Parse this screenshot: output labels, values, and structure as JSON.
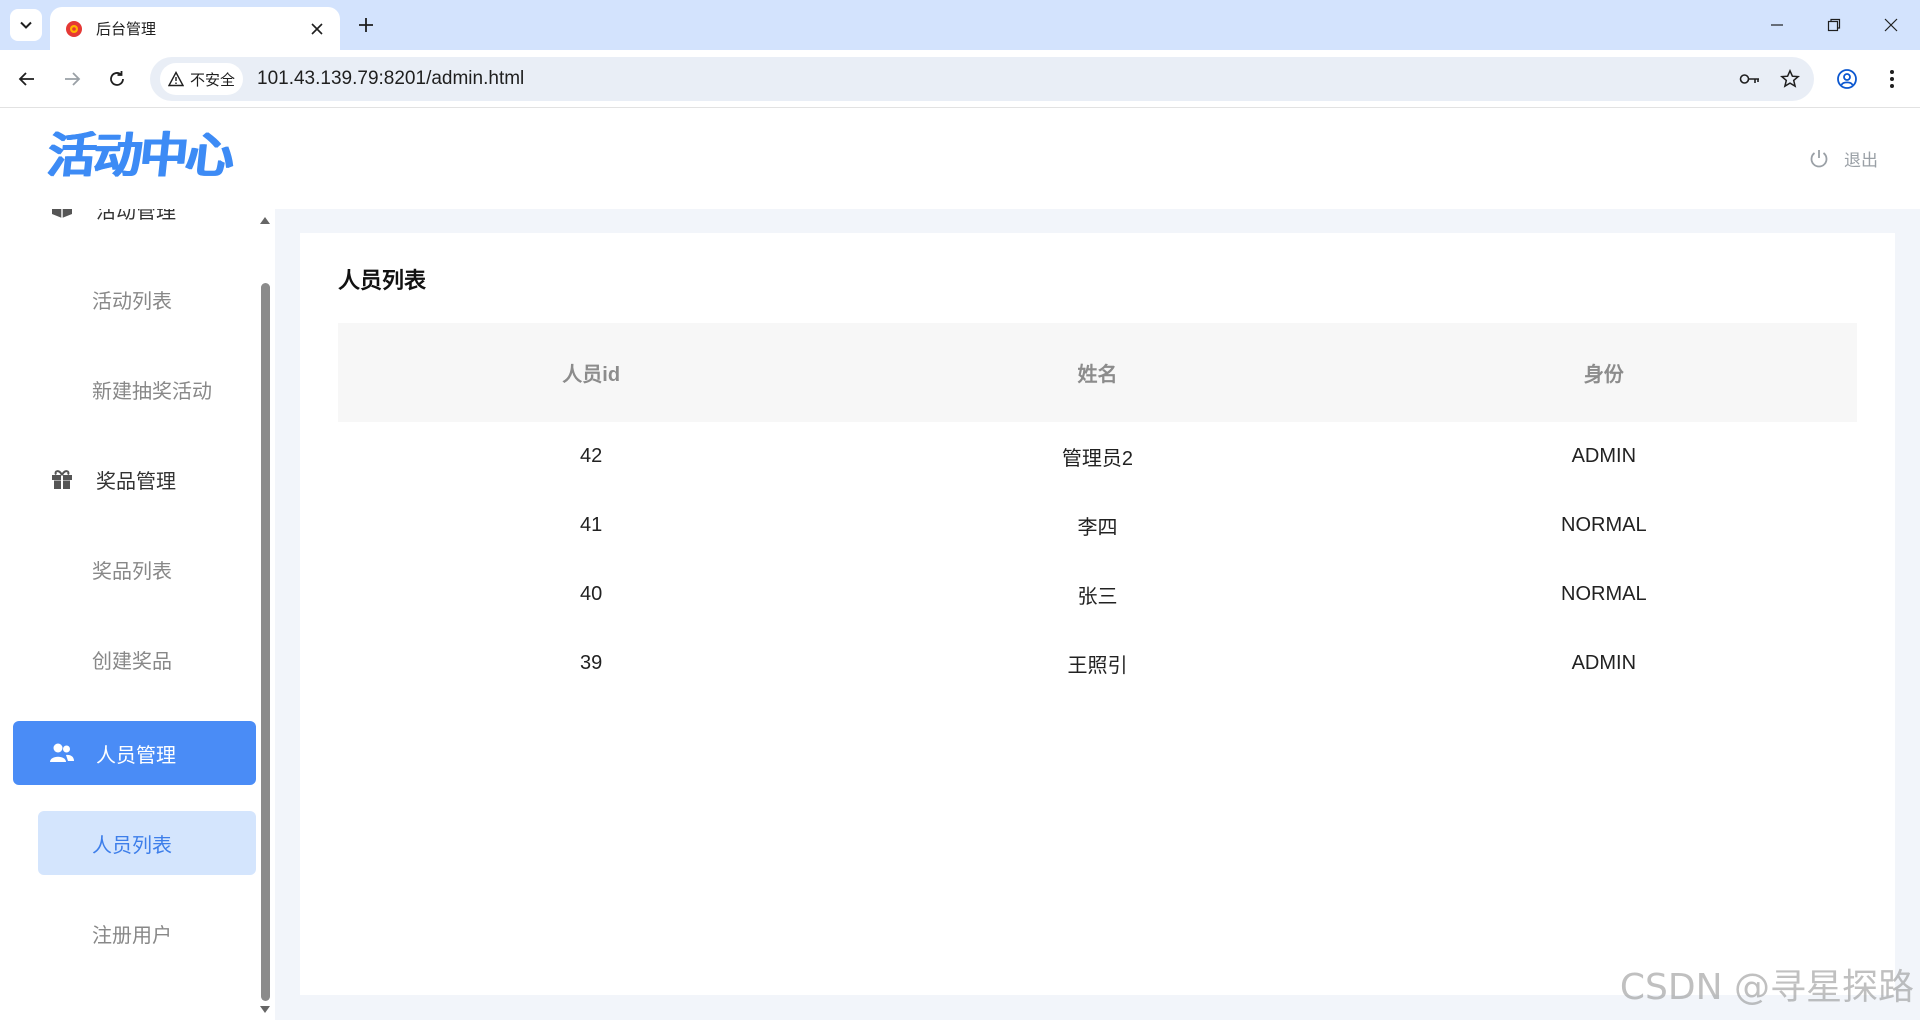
{
  "browser": {
    "tab_title": "后台管理",
    "security_label": "不安全",
    "url": "101.43.139.79:8201/admin.html"
  },
  "header": {
    "logo_text": "活动中心",
    "logout_label": "退出"
  },
  "sidebar": {
    "groups": [
      {
        "label": "活动管理",
        "icon": "box-icon",
        "items": [
          "活动列表",
          "新建抽奖活动"
        ]
      },
      {
        "label": "奖品管理",
        "icon": "gift-icon",
        "items": [
          "奖品列表",
          "创建奖品"
        ]
      },
      {
        "label": "人员管理",
        "icon": "users-icon",
        "active": true,
        "items": [
          "人员列表",
          "注册用户"
        ],
        "active_item": "人员列表"
      }
    ]
  },
  "main": {
    "title": "人员列表",
    "table": {
      "columns": [
        "人员id",
        "姓名",
        "身份"
      ],
      "rows": [
        [
          "42",
          "管理员2",
          "ADMIN"
        ],
        [
          "41",
          "李四",
          "NORMAL"
        ],
        [
          "40",
          "张三",
          "NORMAL"
        ],
        [
          "39",
          "王照引",
          "ADMIN"
        ]
      ]
    }
  },
  "watermark": "CSDN @寻星探路",
  "colors": {
    "accent": "#4a8cf6",
    "active_item_bg": "#d4e5fd",
    "tabbar_bg": "#d3e3fd"
  }
}
